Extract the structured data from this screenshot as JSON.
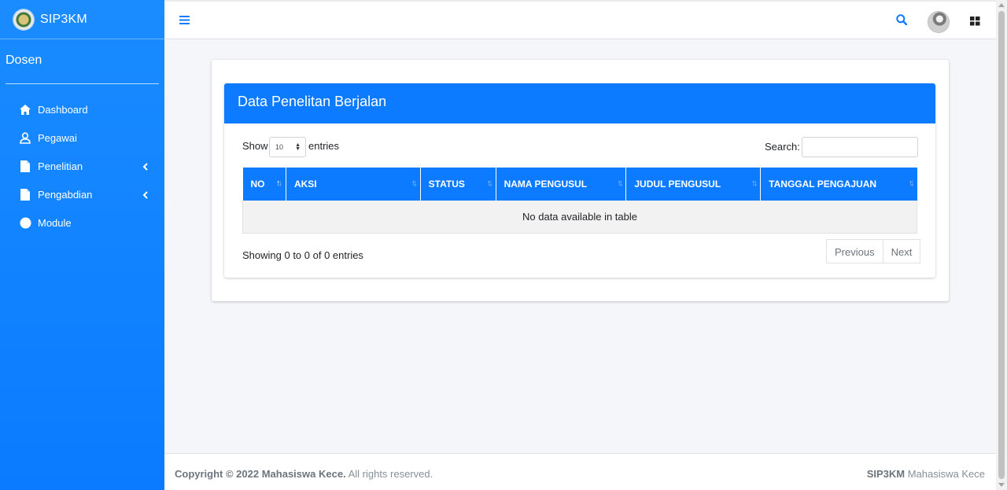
{
  "brand": {
    "title": "SIP3KM"
  },
  "user": {
    "name": "Dosen"
  },
  "sidebar": {
    "items": [
      {
        "label": "Dashboard",
        "icon": "home-icon"
      },
      {
        "label": "Pegawai",
        "icon": "user-icon"
      },
      {
        "label": "Penelitian",
        "icon": "file-icon",
        "has_caret": true
      },
      {
        "label": "Pengabdian",
        "icon": "file-icon",
        "has_caret": true
      },
      {
        "label": "Module",
        "icon": "circle-icon"
      }
    ]
  },
  "card": {
    "title": "Data Penelitan Berjalan"
  },
  "table_controls": {
    "show_label": "Show",
    "page_length": "10",
    "entries_label": "entries",
    "search_label": "Search:",
    "search_value": ""
  },
  "table": {
    "columns": [
      "NO",
      "AKSI",
      "STATUS",
      "NAMA PENGUSUL",
      "JUDUL PENGUSUL",
      "TANGGAL PENGAJUAN"
    ],
    "empty_message": "No data available in table"
  },
  "table_info": "Showing 0 to 0 of 0 entries",
  "pagination": {
    "previous": "Previous",
    "next": "Next"
  },
  "footer": {
    "copyright_prefix": "Copyright © 2022 Mahasiswa Kece.",
    "copyright_suffix": "All rights reserved.",
    "brand": "SIP3KM",
    "brand_suffix": "Mahasiswa Kece"
  },
  "colors": {
    "primary": "#0d7bff",
    "sidebar": "#1a8cff"
  }
}
